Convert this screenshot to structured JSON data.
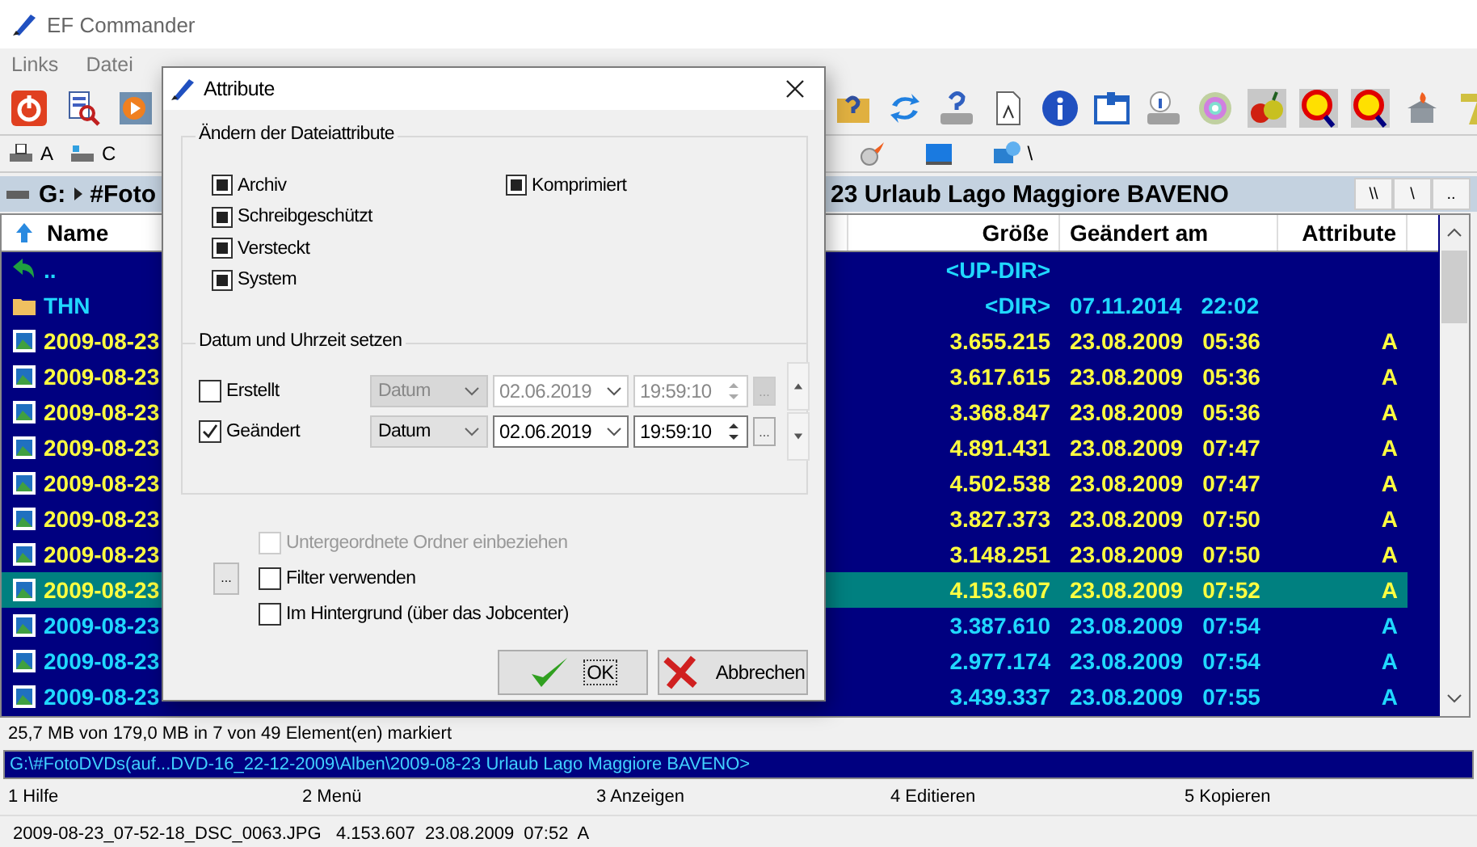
{
  "window": {
    "title": "EF Commander"
  },
  "menu": [
    "Links",
    "Datei"
  ],
  "drives": [
    "A",
    "C"
  ],
  "network_path": "\\",
  "panel": {
    "drive": "G:",
    "path_start": "#Foto",
    "path_end": "23 Urlaub Lago Maggiore BAVENO",
    "nav_buttons": [
      "\\\\",
      "\\",
      ".."
    ],
    "columns": [
      "Name",
      "Größe",
      "Geändert am",
      "Attribute"
    ],
    "rows": [
      {
        "kind": "updir",
        "name": "..",
        "size": "<UP-DIR>",
        "selected": false
      },
      {
        "kind": "dir",
        "name": "THN",
        "size": "<DIR>",
        "date": "07.11.2014",
        "time": "22:02",
        "selected": false
      },
      {
        "kind": "file",
        "name": "2009-08-23",
        "size": "3.655.215",
        "date": "23.08.2009",
        "time": "05:36",
        "attr": "A",
        "marked": true,
        "selected": false
      },
      {
        "kind": "file",
        "name": "2009-08-23",
        "size": "3.617.615",
        "date": "23.08.2009",
        "time": "05:36",
        "attr": "A",
        "marked": true,
        "selected": false
      },
      {
        "kind": "file",
        "name": "2009-08-23",
        "size": "3.368.847",
        "date": "23.08.2009",
        "time": "05:36",
        "attr": "A",
        "marked": true,
        "selected": false
      },
      {
        "kind": "file",
        "name": "2009-08-23",
        "size": "4.891.431",
        "date": "23.08.2009",
        "time": "07:47",
        "attr": "A",
        "marked": true,
        "selected": false
      },
      {
        "kind": "file",
        "name": "2009-08-23",
        "size": "4.502.538",
        "date": "23.08.2009",
        "time": "07:47",
        "attr": "A",
        "marked": true,
        "selected": false
      },
      {
        "kind": "file",
        "name": "2009-08-23",
        "size": "3.827.373",
        "date": "23.08.2009",
        "time": "07:50",
        "attr": "A",
        "marked": true,
        "selected": false
      },
      {
        "kind": "file",
        "name": "2009-08-23",
        "size": "3.148.251",
        "date": "23.08.2009",
        "time": "07:50",
        "attr": "A",
        "marked": true,
        "selected": false
      },
      {
        "kind": "file",
        "name": "2009-08-23",
        "size": "4.153.607",
        "date": "23.08.2009",
        "time": "07:52",
        "attr": "A",
        "marked": true,
        "selected": true
      },
      {
        "kind": "file",
        "name": "2009-08-23",
        "size": "3.387.610",
        "date": "23.08.2009",
        "time": "07:54",
        "attr": "A",
        "marked": false,
        "selected": false
      },
      {
        "kind": "file",
        "name": "2009-08-23",
        "size": "2.977.174",
        "date": "23.08.2009",
        "time": "07:54",
        "attr": "A",
        "marked": false,
        "selected": false
      },
      {
        "kind": "file",
        "name": "2009-08-23",
        "size": "3.439.337",
        "date": "23.08.2009",
        "time": "07:55",
        "attr": "A",
        "marked": false,
        "selected": false
      }
    ]
  },
  "status": "25,7 MB von 179,0 MB in 7 von 49 Element(en) markiert",
  "command_line": "G:\\#FotoDVDs(auf...DVD-16_22-12-2009\\Alben\\2009-08-23 Urlaub Lago Maggiore BAVENO>",
  "function_keys": [
    "1 Hilfe",
    "2 Menü",
    "3 Anzeigen",
    "4 Editieren",
    "5 Kopieren"
  ],
  "file_info": "2009-08-23_07-52-18_DSC_0063.JPG   4.153.607  23.08.2009  07:52  A",
  "dialog": {
    "title": "Attribute",
    "attributes_title": "Ändern der Dateiattribute",
    "attributes_left": [
      {
        "label": "Archiv",
        "indeterminate": true
      },
      {
        "label": "Schreibgeschützt",
        "indeterminate": true
      },
      {
        "label": "Versteckt",
        "indeterminate": true
      },
      {
        "label": "System",
        "indeterminate": true
      }
    ],
    "attributes_right": [
      {
        "label": "Komprimiert",
        "indeterminate": true
      }
    ],
    "date_title": "Datum und Uhrzeit setzen",
    "date_rows": [
      {
        "label": "Erstellt",
        "checked": false,
        "disabled": true,
        "mode": "Datum",
        "date": "02.06.2019",
        "time": "19:59:10",
        "more": "..."
      },
      {
        "label": "Geändert",
        "checked": true,
        "disabled": false,
        "mode": "Datum",
        "date": "02.06.2019",
        "time": "19:59:10",
        "more": "..."
      }
    ],
    "options": [
      {
        "label": "Untergeordnete Ordner einbeziehen",
        "checked": false,
        "disabled": true
      },
      {
        "label": "Filter verwenden",
        "checked": false,
        "disabled": false
      },
      {
        "label": "Im Hintergrund (über das Jobcenter)",
        "checked": false,
        "disabled": false
      }
    ],
    "filter_button": "...",
    "buttons": [
      {
        "kind": "ok",
        "label": "OK"
      },
      {
        "kind": "cancel",
        "label": "Abbrechen"
      }
    ]
  }
}
